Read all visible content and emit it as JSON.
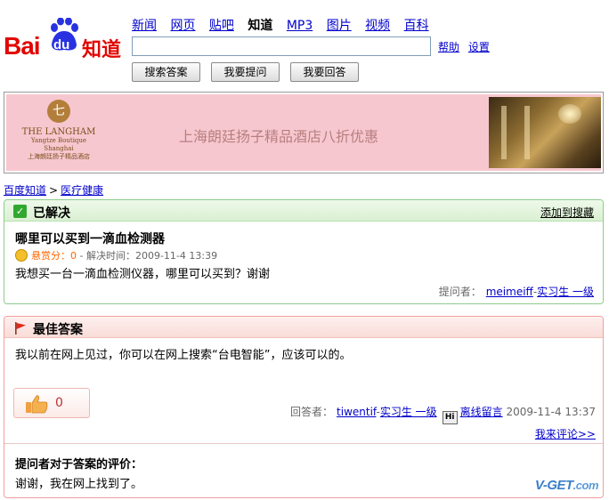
{
  "header": {
    "logo_bai": "Bai",
    "logo_du": "du",
    "logo_zhidao": "知道",
    "nav": [
      {
        "label": "新闻"
      },
      {
        "label": "网页"
      },
      {
        "label": "贴吧"
      },
      {
        "label": "知道"
      },
      {
        "label": "MP3"
      },
      {
        "label": "图片"
      },
      {
        "label": "视频"
      },
      {
        "label": "百科"
      }
    ],
    "search_value": "",
    "help_label": "帮助",
    "settings_label": "设置",
    "buttons": {
      "search_answer": "搜索答案",
      "ask": "我要提问",
      "answer": "我要回答"
    }
  },
  "banner": {
    "hotel_name": "THE LANGHAM",
    "hotel_sub1": "Yangtze Boutique",
    "hotel_sub2": "Shanghai",
    "hotel_sub3": "上海朗廷扬子精品酒店",
    "text": "上海朗廷扬子精品酒店八折优惠"
  },
  "breadcrumb": {
    "root": "百度知道",
    "separator": ">",
    "category": "医疗健康"
  },
  "question": {
    "status": "已解决",
    "add_to_search": "添加到搜藏",
    "title": "哪里可以买到一滴血检测器",
    "reward_label": "悬赏分：0",
    "resolved_time": " - 解决时间：2009-11-4 13:39",
    "body": "我想买一台一滴血检测仪器，哪里可以买到？谢谢",
    "asker_label": "提问者：",
    "asker_name": "meimeiff",
    "asker_level": "实习生 一级"
  },
  "answer": {
    "header": "最佳答案",
    "body": "我以前在网上见过，你可以在网上搜索“台电智能”，应该可以的。",
    "like_count": "0",
    "answerer_label": "回答者：",
    "answerer_name": "tiwentif",
    "answerer_level": "实习生 一级",
    "offline_msg": "离线留言",
    "time": "2009-11-4 13:37",
    "comment_link": "我来评论>>",
    "eval_title": "提问者对于答案的评价：",
    "eval_text": "谢谢，我在网上找到了。"
  },
  "watermark": {
    "main": "V-GET",
    "suffix": ".com"
  },
  "colors": {
    "link": "#0000cc",
    "baidu_red": "#e10601",
    "baidu_blue": "#2932e1",
    "solved_green": "#30a830",
    "banner_pink": "#f7c7cf",
    "reward_orange": "#ff6600"
  }
}
